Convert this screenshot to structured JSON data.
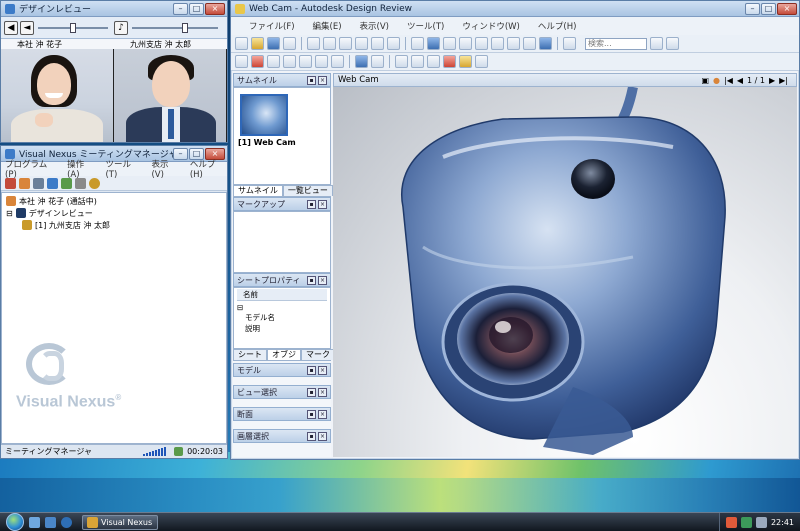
{
  "colors": {
    "accent": "#3c7bc8",
    "titlebar": "#a9c4e2",
    "close": "#c44b3a",
    "webcam_body": "#4a6fa8"
  },
  "video_window": {
    "title": "デザインレビュー",
    "participants": [
      {
        "name": "本社 沖 花子"
      },
      {
        "name": "九州支店 沖 太郎"
      }
    ]
  },
  "meeting_window": {
    "title": "Visual Nexus ミーティングマネージャ",
    "menu": [
      "プログラム(P)",
      "操作(A)",
      "ツール(T)",
      "表示(V)",
      "ヘルプ(H)"
    ],
    "tree": [
      {
        "label": "本社 沖 花子 (通話中)"
      },
      {
        "label": "デザインレビュー"
      },
      {
        "label": "[1] 九州支店 沖 太郎"
      }
    ],
    "logo_text": "Visual Nexus",
    "logo_mark": "®",
    "status_label": "ミーティングマネージャ",
    "status_time": "00:20:03"
  },
  "design_review": {
    "title": "Web Cam - Autodesk Design Review",
    "menu": [
      "ファイル(F)",
      "編集(E)",
      "表示(V)",
      "ツール(T)",
      "ウィンドウ(W)",
      "ヘルプ(H)"
    ],
    "search_placeholder": "検索...",
    "panes": {
      "thumbnails": "サムネイル",
      "thumbnail_item": "[1] Web Cam",
      "tab_thumb": "サムネイル",
      "tab_list": "一覧ビュー",
      "markup": "マークアップ",
      "sheet_props": "シートプロパティ",
      "prop_col": "名前",
      "prop_model": "モデル名",
      "prop_desc": "説明",
      "tab_sheet": "シート",
      "tab_obj": "オブジ",
      "tab_markup": "マーク",
      "model": "モデル",
      "view_select": "ビュー選択",
      "section": "断面",
      "layer_select": "画層選択"
    },
    "doc_tab": "Web Cam",
    "page_indicator": "1 / 1"
  },
  "taskbar": {
    "task_label": "Visual Nexus",
    "clock": "22:41"
  }
}
